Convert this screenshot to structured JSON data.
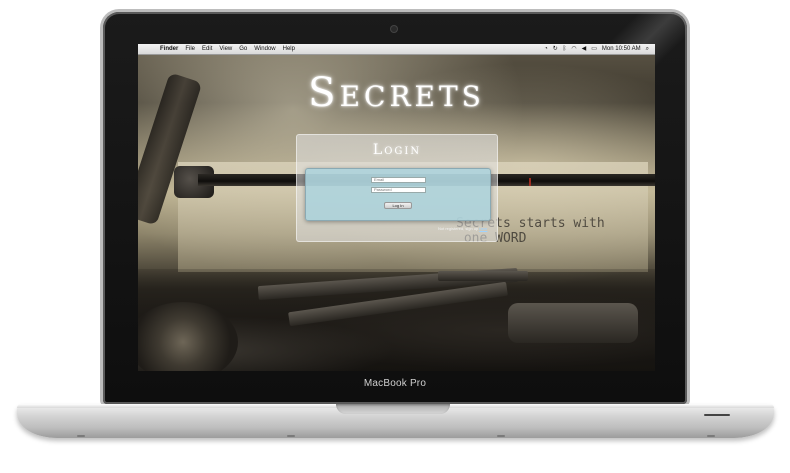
{
  "device": {
    "brand_label": "MacBook Pro"
  },
  "menubar": {
    "apple_glyph": "",
    "menus": [
      "Finder",
      "File",
      "Edit",
      "View",
      "Go",
      "Window",
      "Help"
    ],
    "status_icons": [
      "time-machine-icon",
      "sync-icon",
      "bluetooth-icon",
      "wifi-icon",
      "volume-icon",
      "battery-icon",
      "search-icon"
    ],
    "clock": "Mon 10:50 AM"
  },
  "app": {
    "title": "Secrets",
    "background_text": "Secrets starts with\n one WORD"
  },
  "login": {
    "title": "Login",
    "email_placeholder": "Email",
    "password_placeholder": "Password",
    "button_label": "Log In",
    "register_prefix": "Not registered, sign up ",
    "register_link": "here"
  },
  "colors": {
    "panel": "#aad2dc",
    "link": "#9fd3ff"
  }
}
